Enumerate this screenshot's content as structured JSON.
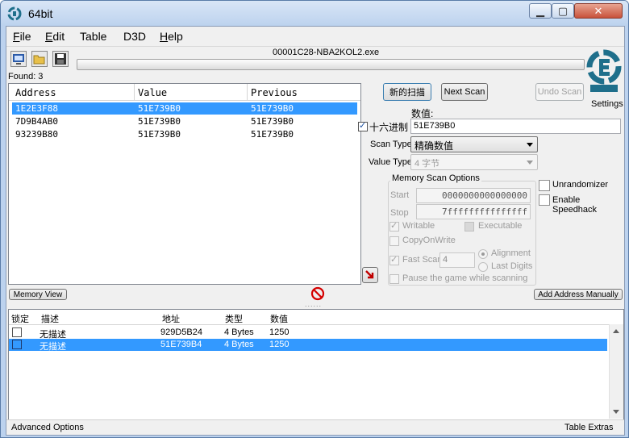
{
  "window": {
    "title": "64bit",
    "controls": [
      "minimize",
      "maximize",
      "close"
    ]
  },
  "menu": [
    {
      "label": "File",
      "key": "F",
      "rest": "ile"
    },
    {
      "label": "Edit",
      "key": "E",
      "rest": "dit"
    },
    {
      "label": "Table",
      "key": "",
      "rest": "Table"
    },
    {
      "label": "D3D",
      "key": "",
      "rest": "D3D"
    },
    {
      "label": "Help",
      "key": "H",
      "rest": "elp"
    }
  ],
  "toolbar": {
    "process_name": "00001C28-NBA2KOL2.exe",
    "found_label": "Found: 3",
    "settings_label": "Settings",
    "progress": 0
  },
  "results": {
    "columns": [
      "Address",
      "Value",
      "Previous"
    ],
    "rows": [
      {
        "address": "1E2E3F88",
        "value": "51E739B0",
        "previous": "51E739B0",
        "selected": true
      },
      {
        "address": "7D9B4AB0",
        "value": "51E739B0",
        "previous": "51E739B0",
        "selected": false
      },
      {
        "address": "93239B80",
        "value": "51E739B0",
        "previous": "51E739B0",
        "selected": false
      }
    ]
  },
  "scan": {
    "new_scan": "新的扫描",
    "next_scan": "Next Scan",
    "undo_scan": "Undo Scan",
    "value_label": "数值:",
    "hex_label": "十六进制",
    "hex_checked": true,
    "value": "51E739B0",
    "scan_type_label": "Scan Type",
    "scan_type_value": "精确数值",
    "value_type_label": "Value Type",
    "value_type_value": "4 字节"
  },
  "memory_options": {
    "title": "Memory Scan Options",
    "start_label": "Start",
    "start_value": "0000000000000000",
    "stop_label": "Stop",
    "stop_value": "7fffffffffffffff",
    "writable_label": "Writable",
    "writable_checked": true,
    "executable_label": "Executable",
    "executable_checked": false,
    "copyonwrite_label": "CopyOnWrite",
    "copyonwrite_checked": false,
    "fastscan_label": "Fast Scan",
    "fastscan_checked": true,
    "fastscan_value": "4",
    "alignment_label": "Alignment",
    "lastdigits_label": "Last Digits",
    "pause_label": "Pause the game while scanning",
    "pause_checked": false
  },
  "options": {
    "unrandomizer_label": "Unrandomizer",
    "speedhack_label": "Enable Speedhack"
  },
  "bottom_buttons": {
    "memory_view": "Memory View",
    "add_address": "Add Address Manually"
  },
  "address_list": {
    "columns": [
      "锁定",
      "描述",
      "地址",
      "类型",
      "数值"
    ],
    "rows": [
      {
        "description": "无描述",
        "address": "929D5B24",
        "type": "4 Bytes",
        "value": "1250",
        "selected": false
      },
      {
        "description": "无描述",
        "address": "51E739B4",
        "type": "4 Bytes",
        "value": "1250",
        "selected": true
      }
    ]
  },
  "statusbar": {
    "left": "Advanced Options",
    "right": "Table Extras"
  },
  "colors": {
    "selection": "#3399ff",
    "window_frame": "#bcd2ee",
    "close_button": "#c8523b",
    "stop_icon": "#d40000",
    "logo": "#1f6f8b"
  }
}
